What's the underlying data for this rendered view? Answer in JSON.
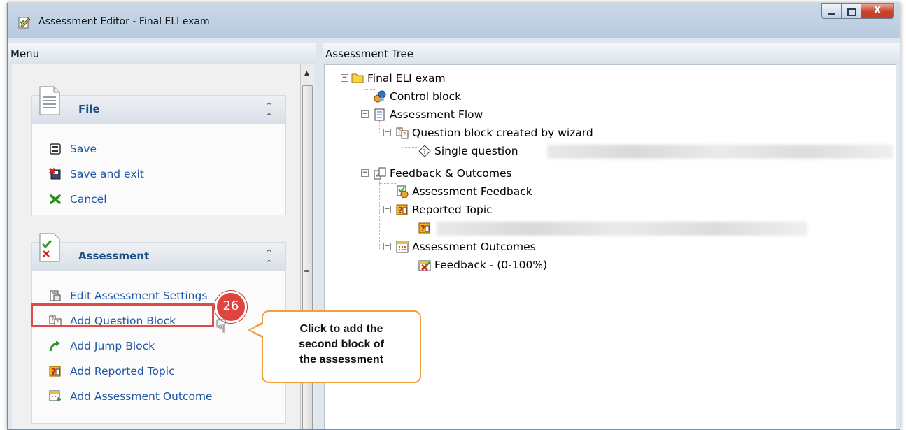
{
  "window": {
    "title": "Assessment Editor - Final ELI exam",
    "close_glyph": "X"
  },
  "menu_panel": {
    "header": "Menu",
    "file_group": {
      "title": "File",
      "items": [
        {
          "label": "Save",
          "icon": "save-icon"
        },
        {
          "label": "Save and exit",
          "icon": "save-exit-icon"
        },
        {
          "label": "Cancel",
          "icon": "cancel-icon"
        }
      ]
    },
    "assessment_group": {
      "title": "Assessment",
      "items": [
        {
          "label": "Edit Assessment Settings",
          "icon": "settings-icon"
        },
        {
          "label": "Add Question Block",
          "icon": "question-block-icon"
        },
        {
          "label": "Add Jump Block",
          "icon": "jump-arrow-icon"
        },
        {
          "label": "Add Reported Topic",
          "icon": "reported-topic-icon"
        },
        {
          "label": "Add Assessment Outcome",
          "icon": "outcome-icon"
        }
      ]
    }
  },
  "tree_panel": {
    "header": "Assessment Tree",
    "nodes": {
      "root": "Final ELI exam",
      "control_block": "Control block",
      "assessment_flow": "Assessment Flow",
      "question_block": "Question block created by wizard",
      "single_question": "Single question",
      "feedback_outcomes": "Feedback & Outcomes",
      "assessment_feedback": "Assessment Feedback",
      "reported_topic": "Reported Topic",
      "assessment_outcomes": "Assessment Outcomes",
      "feedback_range": "Feedback - (0-100%)"
    }
  },
  "annotation": {
    "step_number": "26",
    "callout_lines": [
      "Click to add the",
      "second block of",
      "the assessment"
    ]
  },
  "colors": {
    "link_blue": "#1f57a6",
    "highlight_red": "#e04a4a",
    "callout_orange": "#f0a040"
  }
}
